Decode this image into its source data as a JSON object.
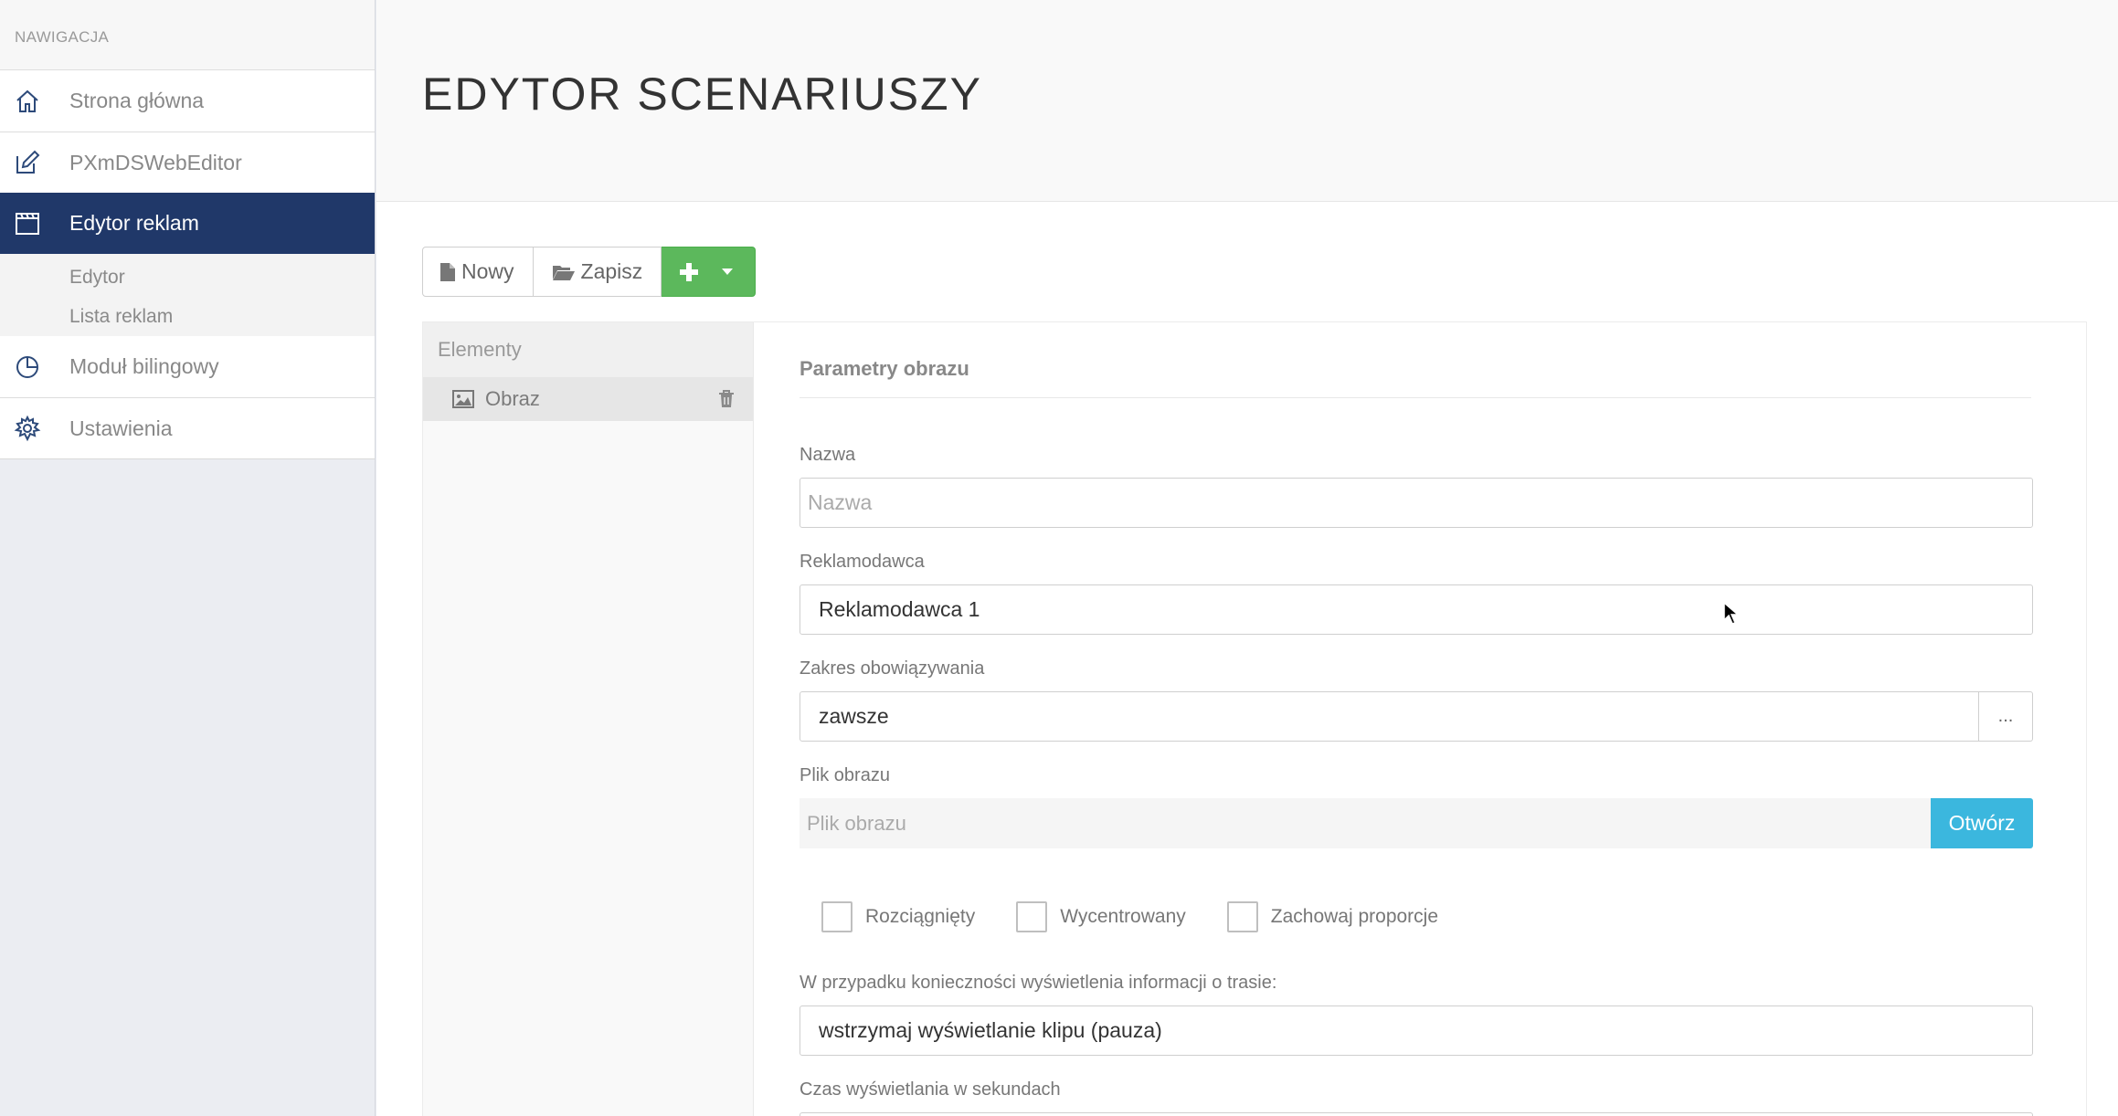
{
  "sidebar": {
    "header": "NAWIGACJA",
    "items": [
      {
        "label": "Strona główna",
        "icon": "home-icon"
      },
      {
        "label": "PXmDSWebEditor",
        "icon": "edit-icon"
      },
      {
        "label": "Edytor reklam",
        "icon": "clapperboard-icon",
        "active": true,
        "sub": [
          {
            "label": "Edytor"
          },
          {
            "label": "Lista reklam"
          }
        ]
      },
      {
        "label": "Moduł bilingowy",
        "icon": "pie-chart-icon"
      },
      {
        "label": "Ustawienia",
        "icon": "gear-icon"
      }
    ]
  },
  "page": {
    "title": "EDYTOR SCENARIUSZY"
  },
  "toolbar": {
    "new_label": "Nowy",
    "save_label": "Zapisz",
    "add_icon": "plus-icon",
    "caret_icon": "caret-down-icon"
  },
  "elements": {
    "title": "Elementy",
    "items": [
      {
        "label": "Obraz",
        "icon": "image-icon",
        "action_icon": "trash-icon"
      }
    ]
  },
  "params": {
    "title": "Parametry obrazu",
    "name": {
      "label": "Nazwa",
      "value": "",
      "placeholder": "Nazwa"
    },
    "advertiser": {
      "label": "Reklamodawca",
      "value": "Reklamodawca 1"
    },
    "validity": {
      "label": "Zakres obowiązywania",
      "value": "zawsze",
      "button": "..."
    },
    "image_file": {
      "label": "Plik obrazu",
      "placeholder": "Plik obrazu",
      "button": "Otwórz"
    },
    "checkboxes": [
      {
        "label": "Rozciągnięty",
        "checked": false
      },
      {
        "label": "Wycentrowany",
        "checked": false
      },
      {
        "label": "Zachowaj proporcje",
        "checked": false
      }
    ],
    "route_info": {
      "label": "W przypadku konieczności wyświetlenia informacji o trasie:",
      "value": "wstrzymaj wyświetlanie klipu (pauza)"
    },
    "duration": {
      "label": "Czas wyświetlania w sekundach"
    }
  },
  "colors": {
    "nav_active": "#203869",
    "primary_green": "#5cb85c",
    "info_blue": "#3bb7de"
  }
}
